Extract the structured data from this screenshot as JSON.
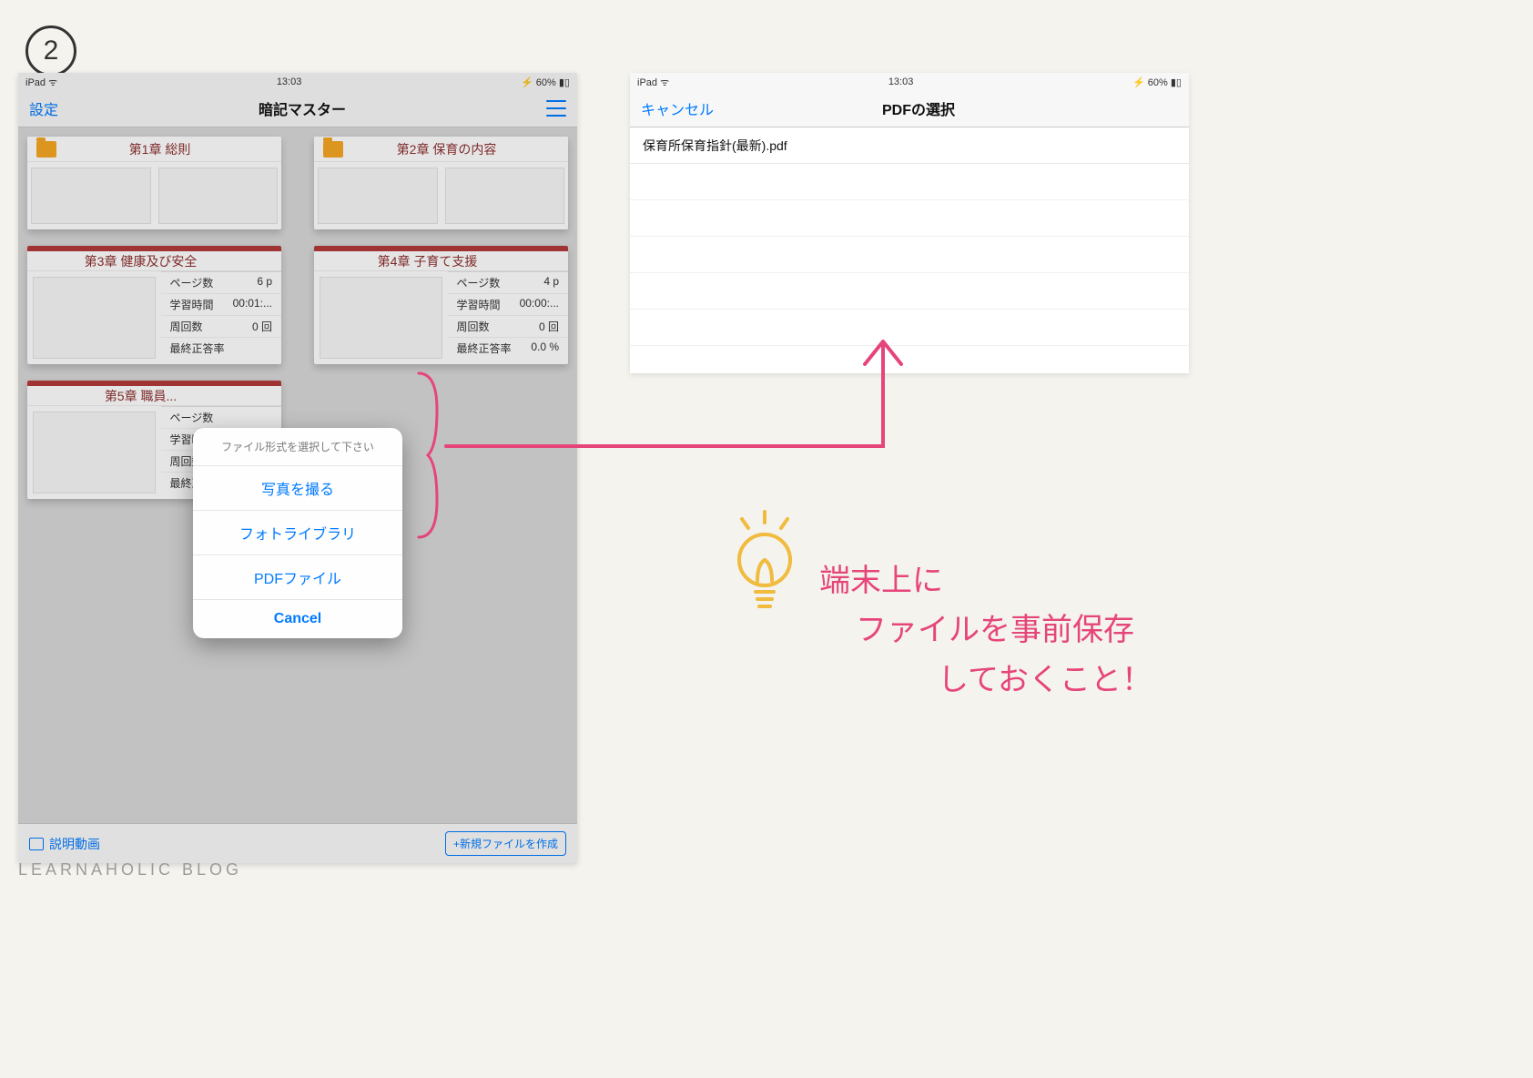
{
  "step_badge": "2",
  "status": {
    "device": "iPad",
    "time": "13:03",
    "battery": "60%"
  },
  "left": {
    "settings_label": "設定",
    "app_title": "暗記マスター",
    "stat_labels": {
      "pages": "ページ数",
      "study": "学習時間",
      "laps": "周回数",
      "accuracy": "最終正答率"
    },
    "cards": [
      {
        "title": "第1章 総則",
        "stats": null
      },
      {
        "title": "第2章 保育の内容",
        "stats": null
      },
      {
        "title": "第3章 健康及び安全",
        "stats": {
          "pages": "6 p",
          "study": "00:01:...",
          "laps": "0 回",
          "accuracy": ""
        }
      },
      {
        "title": "第4章 子育て支援",
        "stats": {
          "pages": "4 p",
          "study": "00:00:...",
          "laps": "0 回",
          "accuracy": "0.0 %"
        }
      },
      {
        "title": "第5章 職員...",
        "stats": {
          "pages": "",
          "study": "",
          "laps": "",
          "accuracy": ""
        }
      }
    ],
    "sheet": {
      "title": "ファイル形式を選択して下さい",
      "items": [
        "写真を撮る",
        "フォトライブラリ",
        "PDFファイル"
      ],
      "cancel": "Cancel"
    },
    "bottom": {
      "video": "説明動画",
      "new_file": "+新規ファイルを作成"
    }
  },
  "right": {
    "cancel": "キャンセル",
    "title": "PDFの選択",
    "file": "保育所保育指針(最新).pdf"
  },
  "handwrite": {
    "line1": "端末上に",
    "line2": "ファイルを事前保存",
    "line3": "しておくこと！"
  },
  "watermark": "LEARNAHOLIC BLOG"
}
